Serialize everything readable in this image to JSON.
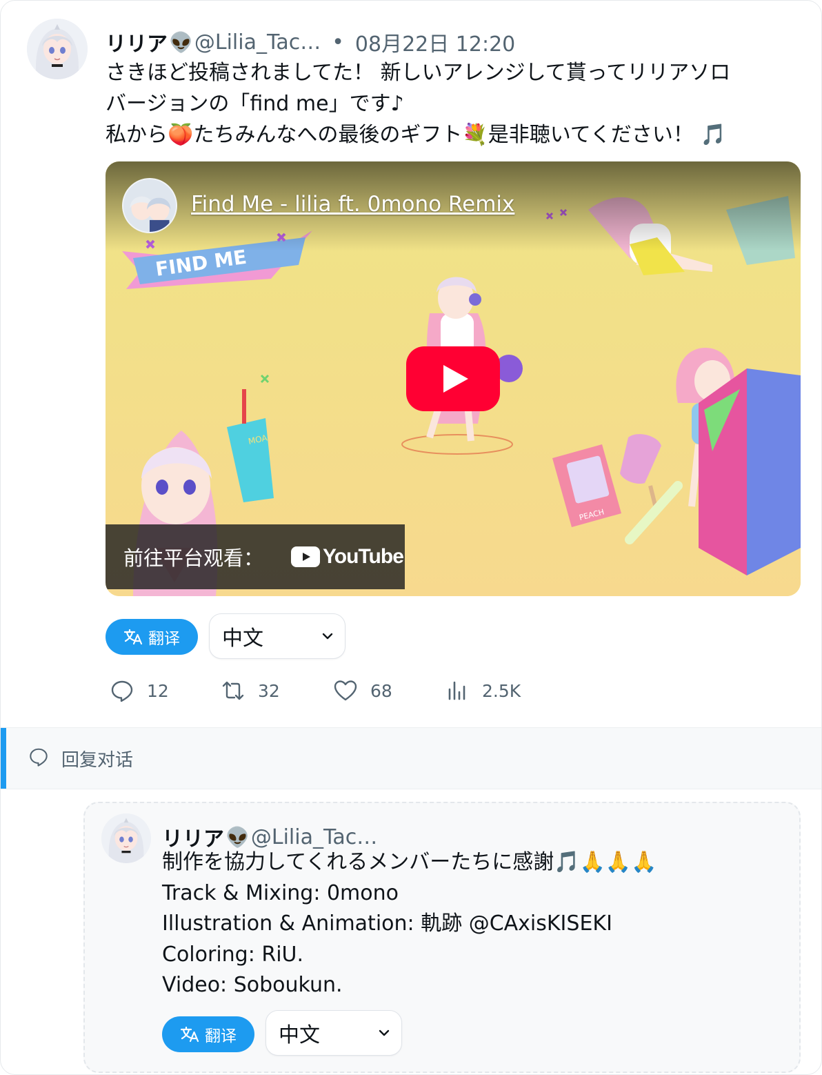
{
  "tweet": {
    "display_name": "リリア",
    "name_emoji": "👽",
    "handle": "@Lilia_Tac…",
    "separator": "•",
    "timestamp": "08月22日 12:20",
    "lines": [
      "さきほど投稿されましてた！ 新しいアレンジして貰ってリリアソロ",
      "バージョンの「find me」です♪",
      "私から🍑たちみんなへの最後のギフト💐是非聴いてください！ 🎵"
    ],
    "embed": {
      "video_title": "Find Me - lilia ft. 0mono Remix",
      "watch_on_label": "前往平台观看：",
      "platform": "YouTube",
      "artwork_text": "FIND ME",
      "peach_text": "PEACH",
      "cup_text": "MOA"
    },
    "translate_label": "翻译",
    "language": "中文",
    "stats": {
      "replies": "12",
      "retweets": "32",
      "likes": "68",
      "views": "2.5K"
    }
  },
  "reply_bar": {
    "label": "回复对话"
  },
  "reply": {
    "display_name": "リリア",
    "name_emoji": "👽",
    "handle": "@Lilia_Tac…",
    "lines": [
      "制作を協力してくれるメンバーたちに感謝🎵🙏🙏🙏",
      "Track & Mixing: 0mono",
      "Illustration & Animation: 軌跡 @CAxisKISEKI",
      "Coloring: RiU.",
      "Video: Soboukun."
    ],
    "translate_label": "翻译",
    "language": "中文"
  },
  "colors": {
    "accent": "#1d9bf0",
    "muted": "#536471",
    "youtube_red": "#ff0033"
  },
  "icons": [
    "avatar",
    "play-button-icon",
    "youtube-logo-icon",
    "translate-icon",
    "chevron-down-icon",
    "reply-icon",
    "retweet-icon",
    "like-icon",
    "views-icon",
    "chat-bubble-icon"
  ]
}
